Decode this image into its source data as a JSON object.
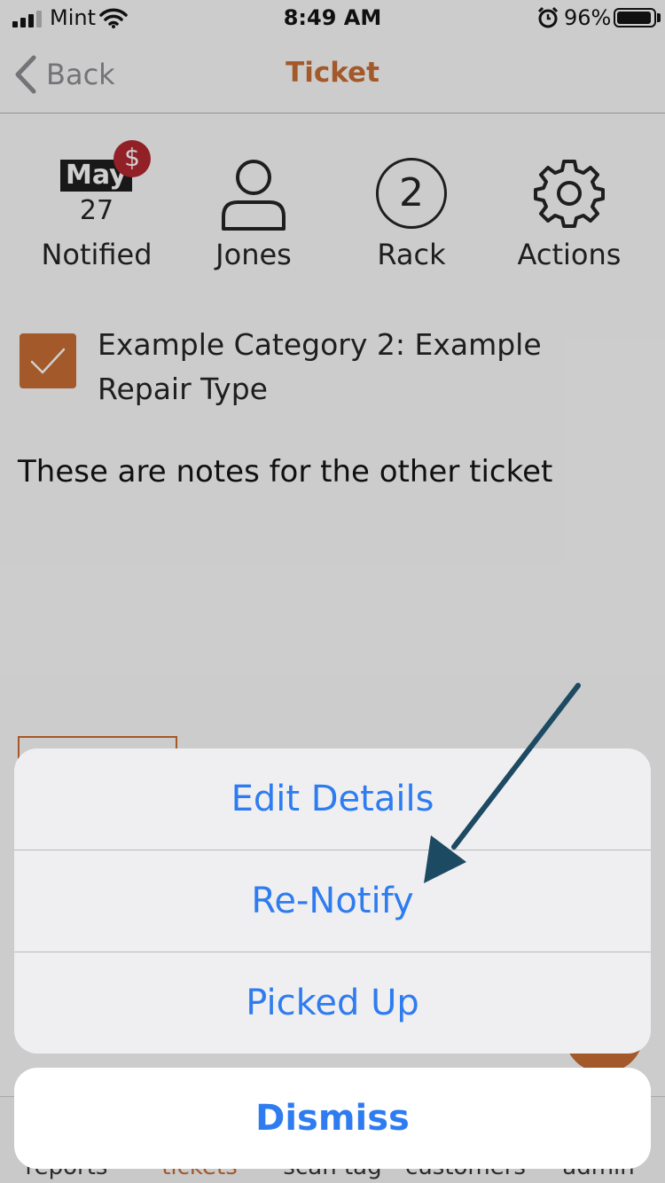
{
  "status_bar": {
    "carrier": "Mint",
    "time": "8:49 AM",
    "battery_percent": "96%",
    "battery_level": 0.96,
    "icons": [
      "signal-icon",
      "wifi-icon",
      "alarm-icon",
      "battery-icon"
    ]
  },
  "nav": {
    "back_label": "Back",
    "title": "Ticket"
  },
  "summary": {
    "calendar": {
      "month": "May",
      "day": "27",
      "badge": "$",
      "label": "Notified"
    },
    "customer": {
      "label": "Jones",
      "icon": "person-icon"
    },
    "rack": {
      "number": "2",
      "label": "Rack"
    },
    "actions": {
      "label": "Actions",
      "icon": "gear-icon"
    }
  },
  "category": {
    "label": "Example Category 2: Example Repair Type",
    "checked": true
  },
  "notes": "These are notes for the other ticket",
  "action_sheet": {
    "options": [
      "Edit Details",
      "Re-Notify",
      "Picked Up"
    ],
    "dismiss_label": "Dismiss"
  },
  "tab_bar": {
    "tabs": [
      "reports",
      "tickets",
      "scan tag",
      "customers",
      "admin"
    ],
    "active": "tickets"
  },
  "colors": {
    "accent": "#c96c2f",
    "ios_blue": "#2e7cf0",
    "badge_red": "#b3262c",
    "annotation_arrow": "#1d4a63"
  }
}
